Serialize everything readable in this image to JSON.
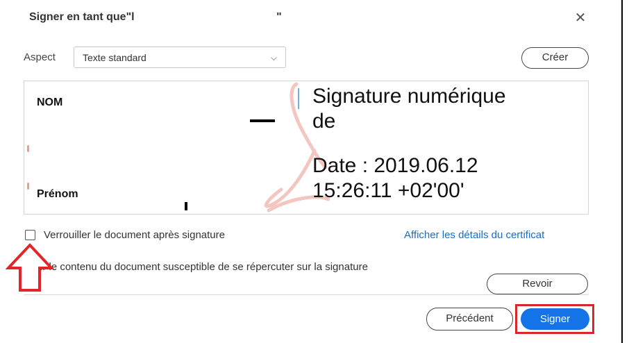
{
  "dialog": {
    "title": "Signer en tant que\"l                                              \"",
    "close_icon": "close-icon"
  },
  "aspect": {
    "label": "Aspect",
    "selected": "Texte standard",
    "create_label": "Créer"
  },
  "preview": {
    "name_label": "NOM",
    "firstname_label": "Prénom",
    "signature_lines": [
      "Signature numérique",
      "de",
      "",
      "Date : 2019.06.12",
      "15:26:11 +02'00'"
    ]
  },
  "options": {
    "lock_label": "Verrouiller le document après signature",
    "lock_checked": false,
    "cert_link": "Afficher les détails du certificat",
    "review_text": "ir le contenu du document susceptible de se répercuter sur la signature",
    "review_button": "Revoir"
  },
  "footer": {
    "previous_label": "Précédent",
    "sign_label": "Signer"
  },
  "colors": {
    "accent": "#1473e6",
    "highlight": "#d9262b",
    "link": "#1a6dc2"
  }
}
